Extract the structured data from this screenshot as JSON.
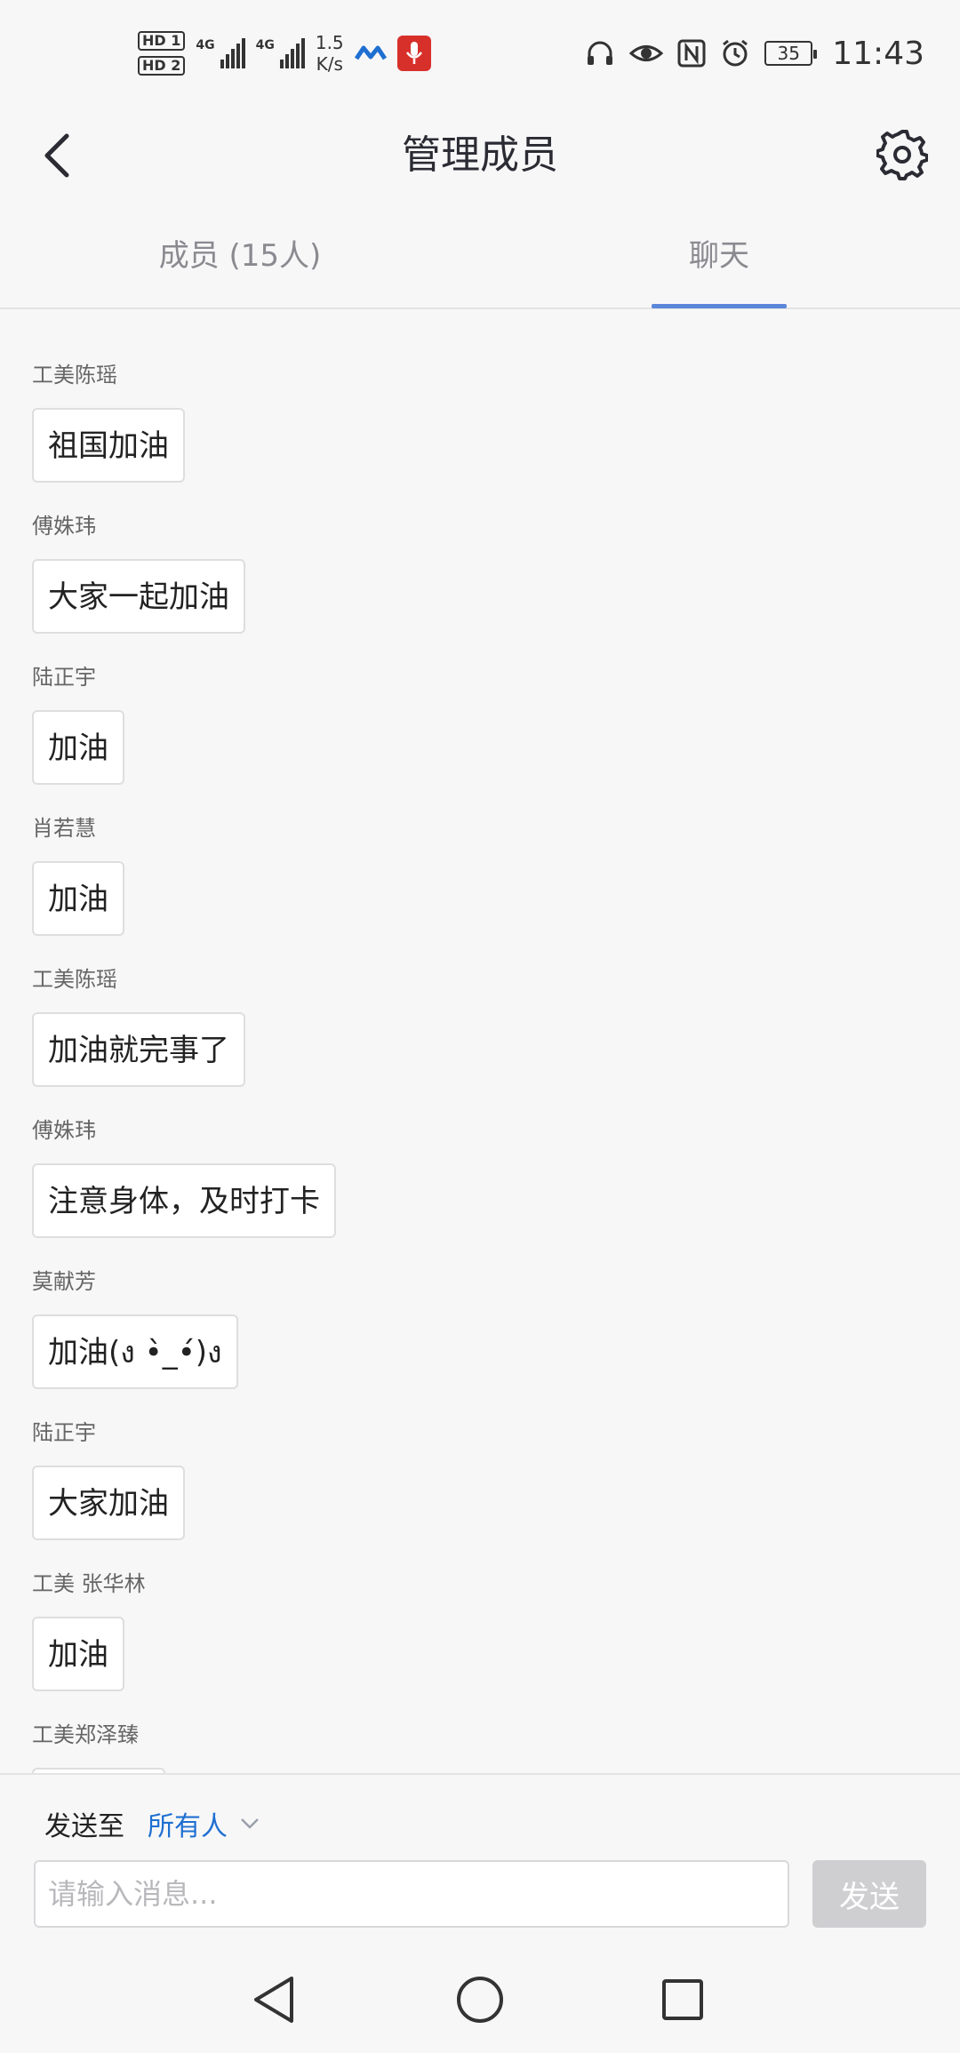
{
  "status_bar": {
    "hd1": "HD 1",
    "hd2": "HD 2",
    "sim1_label": "4G",
    "sim2_label": "4G",
    "speed_value": "1.5",
    "speed_unit": "K/s",
    "battery": "35",
    "time": "11:43",
    "icons": [
      "ble-icon",
      "mic-icon",
      "headset-icon",
      "eye-icon",
      "nfc-icon",
      "alarm-icon"
    ]
  },
  "header": {
    "title": "管理成员",
    "back_icon": "chevron-left-icon",
    "settings_icon": "gear-icon"
  },
  "tabs": [
    {
      "label": "成员 (15人)",
      "active": false
    },
    {
      "label": "聊天",
      "active": true
    }
  ],
  "messages": [
    {
      "sender": "工美陈瑶",
      "text": "祖国加油"
    },
    {
      "sender": "傅姝玮",
      "text": "大家一起加油"
    },
    {
      "sender": "陆正宇",
      "text": "加油"
    },
    {
      "sender": "肖若慧",
      "text": "加油"
    },
    {
      "sender": "工美陈瑶",
      "text": "加油就完事了"
    },
    {
      "sender": "傅姝玮",
      "text": "注意身体，及时打卡"
    },
    {
      "sender": "莫献芳",
      "text": "加油(ง •̀_•́)ง"
    },
    {
      "sender": "陆正宇",
      "text": "大家加油"
    },
    {
      "sender": "工美 张华林",
      "text": "加油"
    },
    {
      "sender": "工美郑泽臻",
      "text": ""
    }
  ],
  "composer": {
    "send_to_label": "发送至",
    "recipient": "所有人",
    "input_placeholder": "请输入消息...",
    "input_value": "",
    "send_label": "发送"
  },
  "colors": {
    "accent": "#5c86d9",
    "link": "#1f6fd1",
    "send_disabled": "#cfcfd2"
  }
}
